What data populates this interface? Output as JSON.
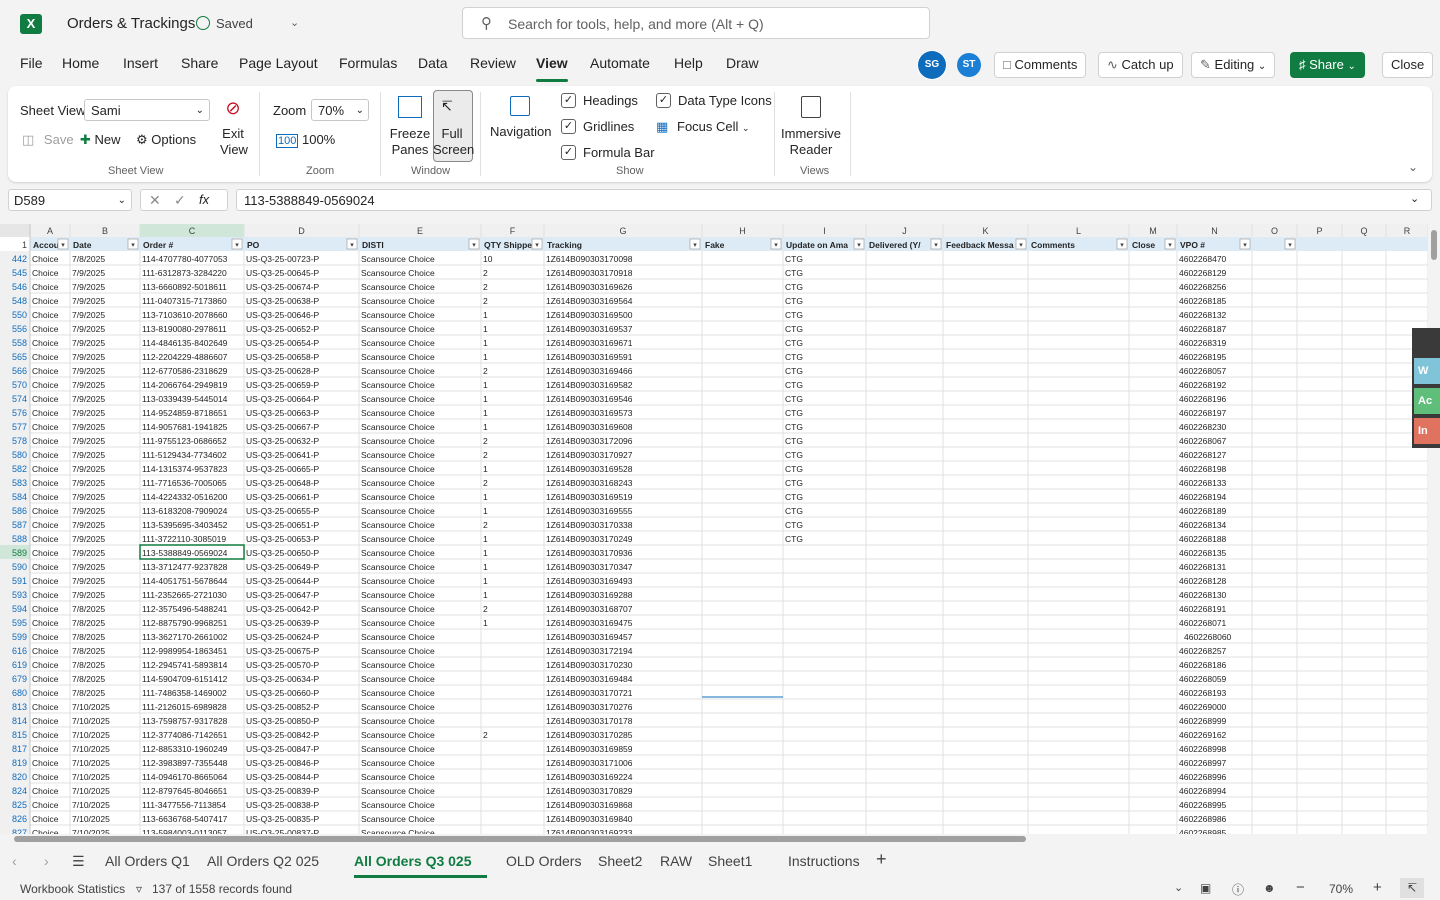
{
  "app": {
    "title": "Orders & Trackings",
    "saved": "Saved",
    "search_placeholder": "Search for tools, help, and more (Alt + Q)"
  },
  "menu": [
    "File",
    "Home",
    "Insert",
    "Share",
    "Page Layout",
    "Formulas",
    "Data",
    "Review",
    "View",
    "Automate",
    "Help",
    "Draw"
  ],
  "avatars": [
    {
      "initials": "SG",
      "color": "#0f6cbd"
    },
    {
      "initials": "ST",
      "color": "#1b7fd6"
    }
  ],
  "top_buttons": {
    "comments": "Comments",
    "catch_up": "Catch up",
    "editing": "Editing",
    "share": "Share",
    "close": "Close"
  },
  "ribbon": {
    "sheet_view_label": "Sheet View",
    "sheet_view_value": "Sami",
    "save": "Save",
    "new": "New",
    "options": "Options",
    "exit_view": "Exit View",
    "sheet_view_group": "Sheet View",
    "zoom_label": "Zoom",
    "zoom_value": "70%",
    "zoom_100": "100%",
    "zoom_group": "Zoom",
    "freeze_panes": "Freeze Panes",
    "full_screen": "Full Screen",
    "window_group": "Window",
    "navigation": "Navigation",
    "headings": "Headings",
    "gridlines": "Gridlines",
    "formula_bar": "Formula Bar",
    "data_type_icons": "Data Type Icons",
    "focus_cell": "Focus Cell",
    "show_group": "Show",
    "immersive_reader": "Immersive Reader",
    "views_group": "Views"
  },
  "formula_bar": {
    "name_box": "D589",
    "value": "113-5388849-0569024"
  },
  "grid": {
    "columns": [
      "A",
      "B",
      "C",
      "D",
      "E",
      "F",
      "G",
      "H",
      "I",
      "J",
      "K",
      "L",
      "M",
      "N",
      "O",
      "P",
      "Q",
      "R"
    ],
    "headers": [
      "Accou",
      "Date",
      "Order #",
      "PO",
      "DISTI",
      "QTY Shippe",
      "Tracking",
      "Fake",
      "Update on Ama",
      "Delivered (Y/",
      "Feedback Messa",
      "Comments",
      "Close",
      "VPO #",
      "",
      "",
      "",
      ""
    ],
    "rows": [
      [
        "442",
        "Choice",
        "7/8/2025",
        "114-4707780-4077053",
        "US-Q3-25-00723-P",
        "Scansource Choice",
        "10",
        "1Z614B090303170098",
        "",
        "CTG",
        "4602268470"
      ],
      [
        "545",
        "Choice",
        "7/9/2025",
        "111-6312873-3284220",
        "US-Q3-25-00645-P",
        "Scansource Choice",
        "2",
        "1Z614B090303170918",
        "",
        "CTG",
        "4602268129"
      ],
      [
        "546",
        "Choice",
        "7/9/2025",
        "113-6660892-5018611",
        "US-Q3-25-00674-P",
        "Scansource Choice",
        "2",
        "1Z614B090303169626",
        "",
        "CTG",
        "4602268256"
      ],
      [
        "548",
        "Choice",
        "7/9/2025",
        "111-0407315-7173860",
        "US-Q3-25-00638-P",
        "Scansource Choice",
        "2",
        "1Z614B090303169564",
        "",
        "CTG",
        "4602268185"
      ],
      [
        "550",
        "Choice",
        "7/9/2025",
        "113-7103610-2078660",
        "US-Q3-25-00646-P",
        "Scansource Choice",
        "1",
        "1Z614B090303169500",
        "",
        "CTG",
        "4602268132"
      ],
      [
        "556",
        "Choice",
        "7/9/2025",
        "113-8190080-2978611",
        "US-Q3-25-00652-P",
        "Scansource Choice",
        "1",
        "1Z614B090303169537",
        "",
        "CTG",
        "4602268187"
      ],
      [
        "558",
        "Choice",
        "7/9/2025",
        "114-4846135-8402649",
        "US-Q3-25-00654-P",
        "Scansource Choice",
        "1",
        "1Z614B090303169671",
        "",
        "CTG",
        "4602268319"
      ],
      [
        "565",
        "Choice",
        "7/9/2025",
        "112-2204229-4886607",
        "US-Q3-25-00658-P",
        "Scansource Choice",
        "1",
        "1Z614B090303169591",
        "",
        "CTG",
        "4602268195"
      ],
      [
        "566",
        "Choice",
        "7/9/2025",
        "112-6770586-2318629",
        "US-Q3-25-00628-P",
        "Scansource Choice",
        "2",
        "1Z614B090303169466",
        "",
        "CTG",
        "4602268057"
      ],
      [
        "570",
        "Choice",
        "7/9/2025",
        "114-2066764-2949819",
        "US-Q3-25-00659-P",
        "Scansource Choice",
        "1",
        "1Z614B090303169582",
        "",
        "CTG",
        "4602268192"
      ],
      [
        "574",
        "Choice",
        "7/9/2025",
        "113-0339439-5445014",
        "US-Q3-25-00664-P",
        "Scansource Choice",
        "1",
        "1Z614B090303169546",
        "",
        "CTG",
        "4602268196"
      ],
      [
        "576",
        "Choice",
        "7/9/2025",
        "114-9524859-8718651",
        "US-Q3-25-00663-P",
        "Scansource Choice",
        "1",
        "1Z614B090303169573",
        "",
        "CTG",
        "4602268197"
      ],
      [
        "577",
        "Choice",
        "7/9/2025",
        "114-9057681-1941825",
        "US-Q3-25-00667-P",
        "Scansource Choice",
        "1",
        "1Z614B090303169608",
        "",
        "CTG",
        "4602268230"
      ],
      [
        "578",
        "Choice",
        "7/9/2025",
        "111-9755123-0686652",
        "US-Q3-25-00632-P",
        "Scansource Choice",
        "2",
        "1Z614B090303172096",
        "",
        "CTG",
        "4602268067"
      ],
      [
        "580",
        "Choice",
        "7/9/2025",
        "111-5129434-7734602",
        "US-Q3-25-00641-P",
        "Scansource Choice",
        "2",
        "1Z614B090303170927",
        "",
        "CTG",
        "4602268127"
      ],
      [
        "582",
        "Choice",
        "7/9/2025",
        "114-1315374-9537823",
        "US-Q3-25-00665-P",
        "Scansource Choice",
        "1",
        "1Z614B090303169528",
        "",
        "CTG",
        "4602268198"
      ],
      [
        "583",
        "Choice",
        "7/9/2025",
        "111-7716536-7005065",
        "US-Q3-25-00648-P",
        "Scansource Choice",
        "2",
        "1Z614B090303168243",
        "",
        "CTG",
        "4602268133"
      ],
      [
        "584",
        "Choice",
        "7/9/2025",
        "114-4224332-0516200",
        "US-Q3-25-00661-P",
        "Scansource Choice",
        "1",
        "1Z614B090303169519",
        "",
        "CTG",
        "4602268194"
      ],
      [
        "586",
        "Choice",
        "7/9/2025",
        "113-6183208-7909024",
        "US-Q3-25-00655-P",
        "Scansource Choice",
        "1",
        "1Z614B090303169555",
        "",
        "CTG",
        "4602268189"
      ],
      [
        "587",
        "Choice",
        "7/9/2025",
        "113-5395695-3403452",
        "US-Q3-25-00651-P",
        "Scansource Choice",
        "2",
        "1Z614B090303170338",
        "",
        "CTG",
        "4602268134"
      ],
      [
        "588",
        "Choice",
        "7/9/2025",
        "111-3722110-3085019",
        "US-Q3-25-00653-P",
        "Scansource Choice",
        "1",
        "1Z614B090303170249",
        "",
        "CTG",
        "4602268188"
      ],
      [
        "589",
        "Choice",
        "7/9/2025",
        "113-5388849-0569024",
        "US-Q3-25-00650-P",
        "Scansource Choice",
        "1",
        "1Z614B090303170936",
        "",
        "",
        "4602268135"
      ],
      [
        "590",
        "Choice",
        "7/9/2025",
        "113-3712477-9237828",
        "US-Q3-25-00649-P",
        "Scansource Choice",
        "1",
        "1Z614B090303170347",
        "",
        "",
        "4602268131"
      ],
      [
        "591",
        "Choice",
        "7/9/2025",
        "114-4051751-5678644",
        "US-Q3-25-00644-P",
        "Scansource Choice",
        "1",
        "1Z614B090303169493",
        "",
        "",
        "4602268128"
      ],
      [
        "593",
        "Choice",
        "7/9/2025",
        "111-2352665-2721030",
        "US-Q3-25-00647-P",
        "Scansource Choice",
        "1",
        "1Z614B090303169288",
        "",
        "",
        "4602268130"
      ],
      [
        "594",
        "Choice",
        "7/8/2025",
        "112-3575496-5488241",
        "US-Q3-25-00642-P",
        "Scansource Choice",
        "2",
        "1Z614B090303168707",
        "",
        "",
        "4602268191"
      ],
      [
        "595",
        "Choice",
        "7/8/2025",
        "112-8875790-9968251",
        "US-Q3-25-00639-P",
        "Scansource Choice",
        "1",
        "1Z614B090303169475",
        "",
        "",
        "4602268071"
      ],
      [
        "599",
        "Choice",
        "7/8/2025",
        "113-3627170-2661002",
        "US-Q3-25-00624-P",
        "Scansource Choice",
        "",
        "1Z614B090303169457",
        "",
        "",
        "4602268060"
      ],
      [
        "616",
        "Choice",
        "7/8/2025",
        "112-9989954-1863451",
        "US-Q3-25-00675-P",
        "Scansource Choice",
        "",
        "1Z614B090303172194",
        "",
        "",
        "4602268257"
      ],
      [
        "619",
        "Choice",
        "7/8/2025",
        "112-2945741-5893814",
        "US-Q3-25-00570-P",
        "Scansource Choice",
        "",
        "1Z614B090303170230",
        "",
        "",
        "4602268186"
      ],
      [
        "679",
        "Choice",
        "7/8/2025",
        "114-5904709-6151412",
        "US-Q3-25-00634-P",
        "Scansource Choice",
        "",
        "1Z614B090303169484",
        "",
        "",
        "4602268059"
      ],
      [
        "680",
        "Choice",
        "7/8/2025",
        "111-7486358-1469002",
        "US-Q3-25-00660-P",
        "Scansource Choice",
        "",
        "1Z614B090303170721",
        "",
        "",
        "4602268193"
      ],
      [
        "813",
        "Choice",
        "7/10/2025",
        "111-2126015-6989828",
        "US-Q3-25-00852-P",
        "Scansource Choice",
        "",
        "1Z614B090303170276",
        "",
        "",
        "4602269000"
      ],
      [
        "814",
        "Choice",
        "7/10/2025",
        "113-7598757-9317828",
        "US-Q3-25-00850-P",
        "Scansource Choice",
        "",
        "1Z614B090303170178",
        "",
        "",
        "4602268999"
      ],
      [
        "815",
        "Choice",
        "7/10/2025",
        "112-3774086-7142651",
        "US-Q3-25-00842-P",
        "Scansource Choice",
        "2",
        "1Z614B090303170285",
        "",
        "",
        "4602269162"
      ],
      [
        "817",
        "Choice",
        "7/10/2025",
        "112-8853310-1960249",
        "US-Q3-25-00847-P",
        "Scansource Choice",
        "",
        "1Z614B090303169859",
        "",
        "",
        "4602268998"
      ],
      [
        "819",
        "Choice",
        "7/10/2025",
        "112-3983897-7355448",
        "US-Q3-25-00846-P",
        "Scansource Choice",
        "",
        "1Z614B090303171006",
        "",
        "",
        "4602268997"
      ],
      [
        "820",
        "Choice",
        "7/10/2025",
        "114-0946170-8665064",
        "US-Q3-25-00844-P",
        "Scansource Choice",
        "",
        "1Z614B090303169224",
        "",
        "",
        "4602268996"
      ],
      [
        "824",
        "Choice",
        "7/10/2025",
        "112-8797645-8046651",
        "US-Q3-25-00839-P",
        "Scansource Choice",
        "",
        "1Z614B090303170829",
        "",
        "",
        "4602268994"
      ],
      [
        "825",
        "Choice",
        "7/10/2025",
        "111-3477556-7113854",
        "US-Q3-25-00838-P",
        "Scansource Choice",
        "",
        "1Z614B090303169868",
        "",
        "",
        "4602268995"
      ],
      [
        "826",
        "Choice",
        "7/10/2025",
        "113-6636768-5407417",
        "US-Q3-25-00835-P",
        "Scansource Choice",
        "",
        "1Z614B090303169840",
        "",
        "",
        "4602268986"
      ],
      [
        "827",
        "Choice",
        "7/10/2025",
        "113-5984003-0113057",
        "US-Q3-25-00837-P",
        "Scansource Choice",
        "",
        "1Z614B090303169233",
        "",
        "",
        "4602268985"
      ]
    ],
    "selected_row": "589",
    "colors": {
      "header_fill": "#ddebf7",
      "selected_header": "#cfe6d8",
      "grid_line": "#e1e1e1",
      "accent": "#107c41"
    }
  },
  "side_panel": [
    {
      "label": "W",
      "color": "#7fc4d8"
    },
    {
      "label": "Ac",
      "color": "#5fbf7a"
    },
    {
      "label": "In",
      "color": "#e0735f"
    }
  ],
  "sheet_tabs": [
    "All Orders Q1",
    "All Orders Q2 025",
    "All Orders Q3 025",
    "OLD Orders",
    "Sheet2",
    "RAW",
    "Sheet1",
    "Instructions"
  ],
  "active_tab": "All Orders Q3 025",
  "status": {
    "workbook_stats": "Workbook Statistics",
    "records": "137 of 1558 records found",
    "zoom": "70%"
  }
}
